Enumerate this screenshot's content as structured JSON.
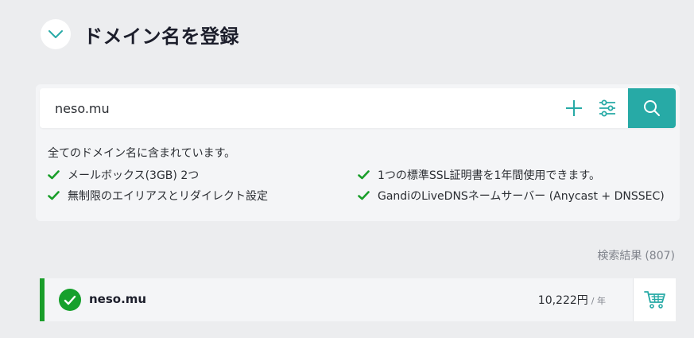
{
  "header": {
    "title": "ドメイン名を登録",
    "toggle_icon": "chevron-down-icon"
  },
  "search": {
    "value": "neso.mu",
    "placeholder": "",
    "add_icon": "plus-icon",
    "filter_icon": "sliders-icon",
    "search_icon": "search-icon"
  },
  "includes": {
    "title": "全てのドメイン名に含まれています。",
    "features": [
      "メールボックス(3GB) 2つ",
      "無制限のエイリアスとリダイレクト設定",
      "1つの標準SSL証明書を1年間使用できます。",
      "GandiのLiveDNSネームサーバー (Anycast + DNSSEC)"
    ]
  },
  "results": {
    "label": "検索結果",
    "count": "(807)",
    "items": [
      {
        "domain": "neso.mu",
        "price": "10,222円",
        "unit": "/ 年",
        "status": "available"
      }
    ]
  },
  "colors": {
    "accent": "#27aaa6",
    "available": "#16a02c",
    "background": "#ecedef"
  }
}
